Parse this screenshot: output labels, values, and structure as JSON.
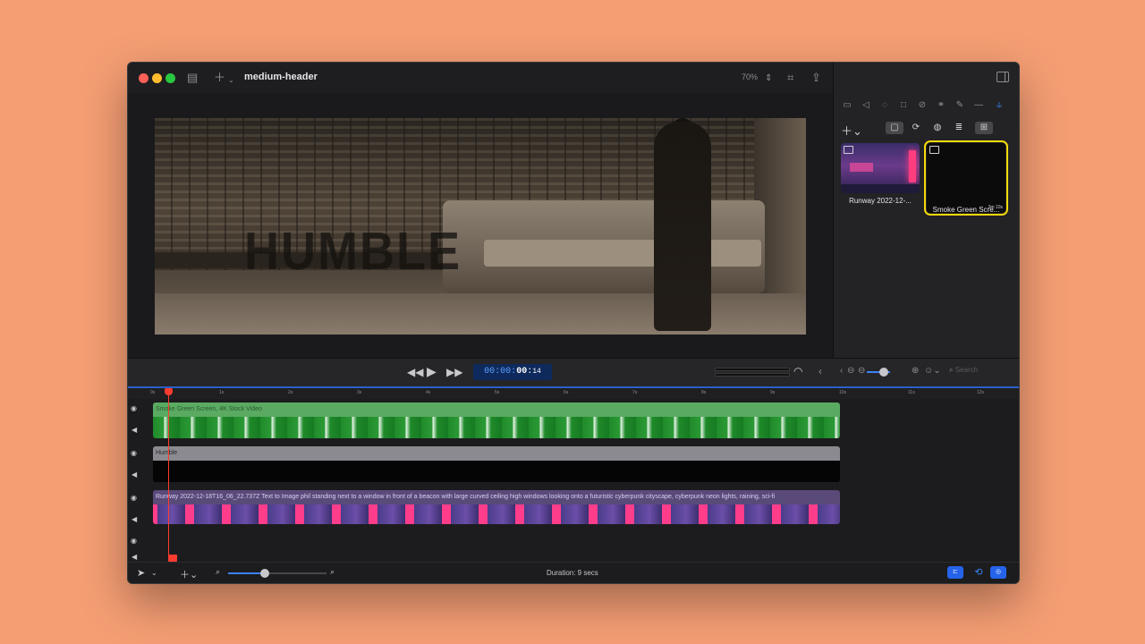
{
  "window": {
    "title": "medium-header",
    "zoom": "70%"
  },
  "preview": {
    "overlay_text": "HUMBLE"
  },
  "transport": {
    "timecode_prefix": "00:00:",
    "timecode_main": "00",
    "timecode_frames": "14"
  },
  "right_panel": {
    "search_placeholder": "Search",
    "media": [
      {
        "label": "Runway 2022-12-...",
        "type": "image-icon"
      },
      {
        "label": "Smoke Green Scre...",
        "type": "film-icon",
        "badge": "3m 10s"
      }
    ]
  },
  "timeline": {
    "ticks": [
      "0s",
      "1s",
      "2s",
      "3s",
      "4s",
      "5s",
      "6s",
      "7s",
      "8s",
      "9s",
      "10s",
      "11s",
      "12s"
    ],
    "tracks": [
      {
        "name": "Smoke Green Screen, 4K Stock Video",
        "style": "green"
      },
      {
        "name": "Humble",
        "style": "gray"
      },
      {
        "name": "Runway 2022-12-18T16_06_22.737Z Text to Image phil standing next to a window in front of a beacon with large curved ceiling high windows looking onto a futuristic cyberpunk cityscape, cyberpunk neon lights, raining, sci-fi",
        "style": "purple"
      }
    ]
  },
  "status": {
    "duration": "Duration: 9 secs"
  },
  "colors": {
    "accent": "#3b82f6",
    "playhead": "#ff3b30",
    "selection": "#f5d90a",
    "background": "#F59E74"
  }
}
